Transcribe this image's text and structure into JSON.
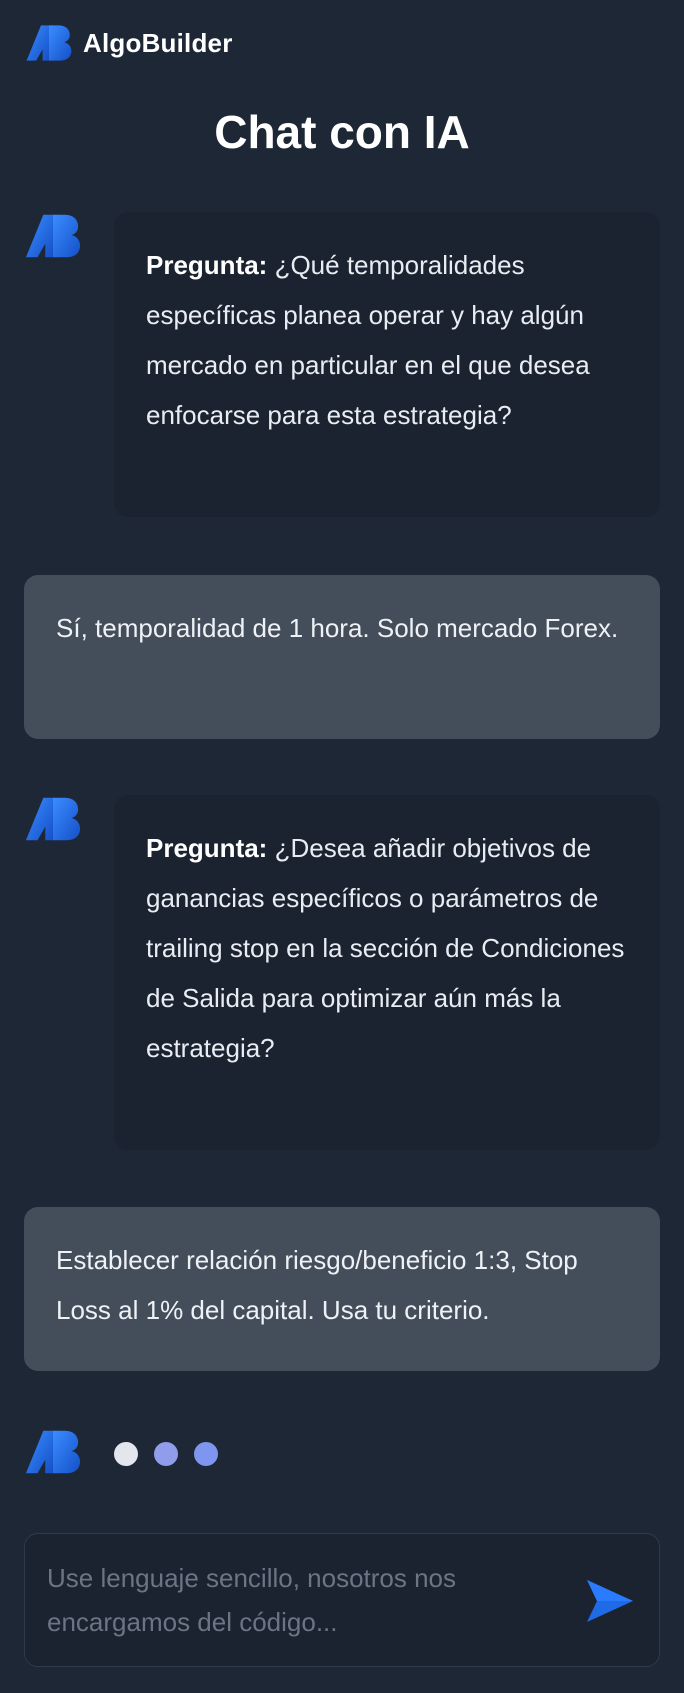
{
  "brand": {
    "name": "AlgoBuilder",
    "logo_icon": "algobuilder-logo-icon"
  },
  "page": {
    "title": "Chat con IA"
  },
  "colors": {
    "background": "#1e2735",
    "bot_bubble": "#1a232f",
    "user_bubble": "#444e5b",
    "accent": "#1f6be6"
  },
  "messages": [
    {
      "role": "bot",
      "prefix": "Pregunta:",
      "text": "¿Qué temporalidades específicas planea operar y hay algún mercado en particular en el que desea enfocarse para esta estrategia?"
    },
    {
      "role": "user",
      "text": "Sí, temporalidad de 1 hora. Solo mercado Forex."
    },
    {
      "role": "bot",
      "prefix": "Pregunta:",
      "text": "¿Desea añadir objetivos de ganancias específicos o parámetros de trailing stop en la sección de Condiciones de Salida para optimizar aún más la estrategia?"
    },
    {
      "role": "user",
      "text": "Establecer relación riesgo/beneficio 1:3, Stop Loss al 1% del capital. Usa tu criterio."
    }
  ],
  "typing_indicator": {
    "icon": "typing-dots-icon"
  },
  "composer": {
    "placeholder": "Use lenguaje sencillo, nosotros nos encargamos del código...",
    "value": "",
    "send_icon": "send-icon"
  }
}
